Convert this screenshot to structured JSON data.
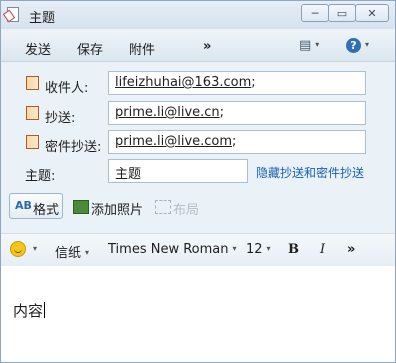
{
  "window": {
    "title": "主题",
    "buttons": [
      "─",
      "▭",
      "✕"
    ]
  },
  "toolbar": {
    "send": "发送",
    "save": "保存",
    "attach": "附件",
    "more": "»"
  },
  "headers": {
    "to": {
      "label": "收件人:",
      "value": "lifeizhuhai@163.com",
      "sep": ";"
    },
    "cc": {
      "label": "抄送:",
      "value": "prime.li@live.cn",
      "sep": ";"
    },
    "bcc": {
      "label": "密件抄送:",
      "value": "prime.li@live.com",
      "sep": ";"
    },
    "subject": {
      "label": "主题:",
      "value": "主题"
    },
    "hide_link": "隐藏抄送和密件抄送"
  },
  "actions": {
    "format": "格式",
    "format_icon": "AB",
    "add_photo": "添加照片",
    "layout": "布局"
  },
  "format_bar": {
    "stationery": "信纸",
    "font": "Times New Roman",
    "size": "12",
    "bold": "B",
    "italic": "I",
    "more": "»"
  },
  "body": {
    "text": "内容"
  }
}
